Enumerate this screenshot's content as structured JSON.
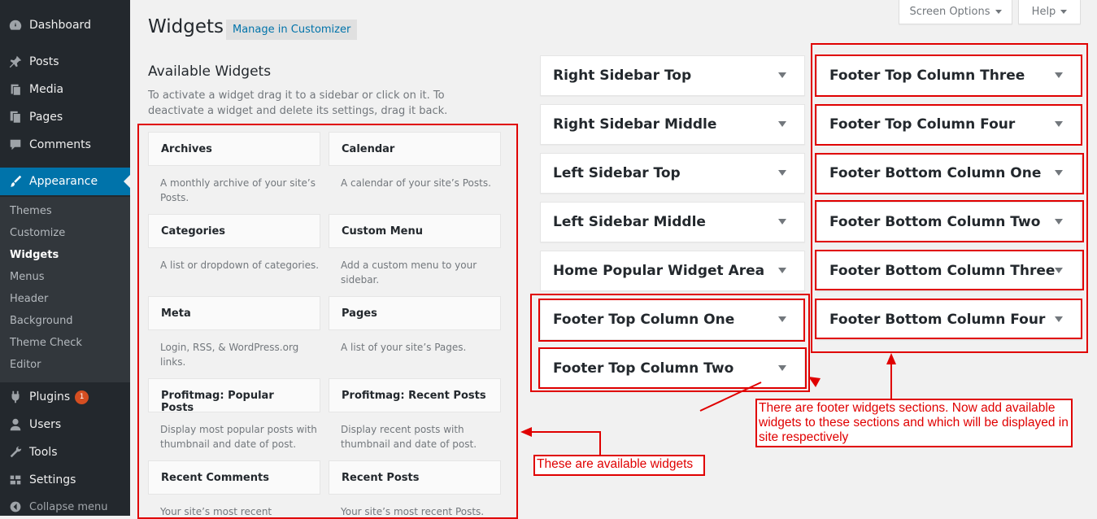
{
  "sidebar": {
    "dashboard": "Dashboard",
    "posts": "Posts",
    "media": "Media",
    "pages": "Pages",
    "comments": "Comments",
    "appearance": "Appearance",
    "submenu": [
      "Themes",
      "Customize",
      "Widgets",
      "Menus",
      "Header",
      "Background",
      "Theme Check",
      "Editor"
    ],
    "plugins": "Plugins",
    "plugins_badge": "1",
    "users": "Users",
    "tools": "Tools",
    "settings": "Settings",
    "collapse": "Collapse menu"
  },
  "header": {
    "title": "Widgets",
    "manage_customizer": "Manage in Customizer",
    "screen_options": "Screen Options",
    "help": "Help"
  },
  "available": {
    "title": "Available Widgets",
    "description": "To activate a widget drag it to a sidebar or click on it. To deactivate a widget and delete its settings, drag it back.",
    "widgets": [
      {
        "title": "Archives",
        "desc": "A monthly archive of your site’s Posts."
      },
      {
        "title": "Calendar",
        "desc": "A calendar of your site’s Posts."
      },
      {
        "title": "Categories",
        "desc": "A list or dropdown of categories."
      },
      {
        "title": "Custom Menu",
        "desc": "Add a custom menu to your sidebar."
      },
      {
        "title": "Meta",
        "desc": "Login, RSS, & WordPress.org links."
      },
      {
        "title": "Pages",
        "desc": "A list of your site’s Pages."
      },
      {
        "title": "Profitmag: Popular Posts",
        "desc": "Display most popular posts with thumbnail and date of post."
      },
      {
        "title": "Profitmag: Recent Posts",
        "desc": "Display recent posts with thumbnail and date of post."
      },
      {
        "title": "Recent Comments",
        "desc": "Your site’s most recent"
      },
      {
        "title": "Recent Posts",
        "desc": "Your site’s most recent Posts."
      }
    ]
  },
  "areas_left": [
    "Right Sidebar Top",
    "Right Sidebar Middle",
    "Left Sidebar Top",
    "Left Sidebar Middle",
    "Home Popular Widget Area",
    "Footer Top Column One",
    "Footer Top Column Two"
  ],
  "areas_right": [
    "Footer Top Column Three",
    "Footer Top Column Four",
    "Footer Bottom Column One",
    "Footer Bottom Column Two",
    "Footer Bottom Column Three",
    "Footer Bottom Column Four"
  ],
  "annotations": {
    "available": "These are available widgets",
    "footer": "There are footer widgets sections. Now add available widgets to these sections and which will be displayed in site respectively"
  },
  "colors": {
    "accent": "#0073aa",
    "annotation": "#e00000",
    "sidebar_bg": "#23282d"
  }
}
